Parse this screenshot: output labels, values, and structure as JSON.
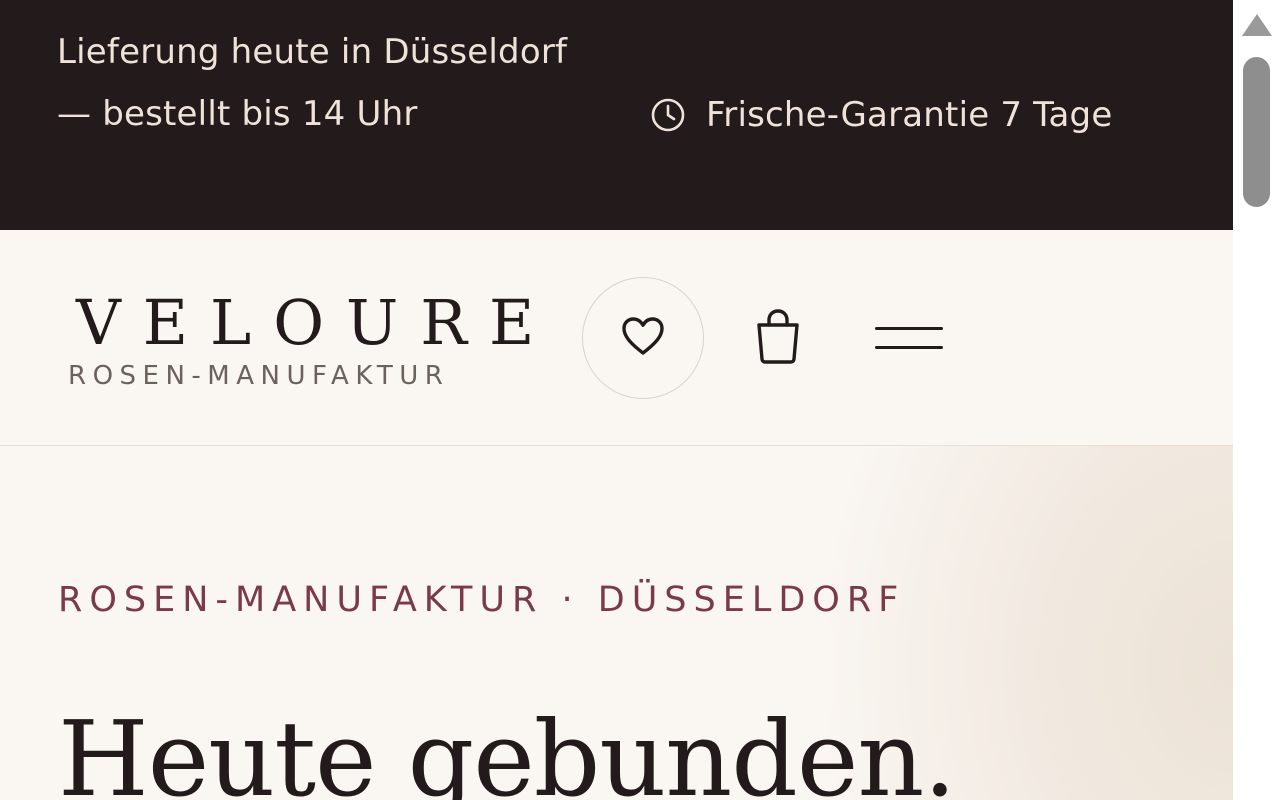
{
  "announcement": {
    "delivery_text": "Lieferung heute in Düsseldorf — bestellt bis 14 Uhr",
    "guarantee_icon": "clock-icon",
    "guarantee_text": "Frische-Garantie 7 Tage"
  },
  "header": {
    "brand": "VELOURE",
    "tagline": "ROSEN-MANUFAKTUR",
    "wishlist_icon": "heart-icon",
    "cart_icon": "shopping-bag-icon",
    "menu_icon": "hamburger-menu-icon"
  },
  "hero": {
    "eyebrow": "ROSEN-MANUFAKTUR · DÜSSELDORF",
    "headline": "Heute gebunden."
  },
  "colors": {
    "announcement_bg": "#231a1b",
    "page_bg": "#faf6f2",
    "accent": "#7a3a4a",
    "text_dark": "#231a1b"
  }
}
